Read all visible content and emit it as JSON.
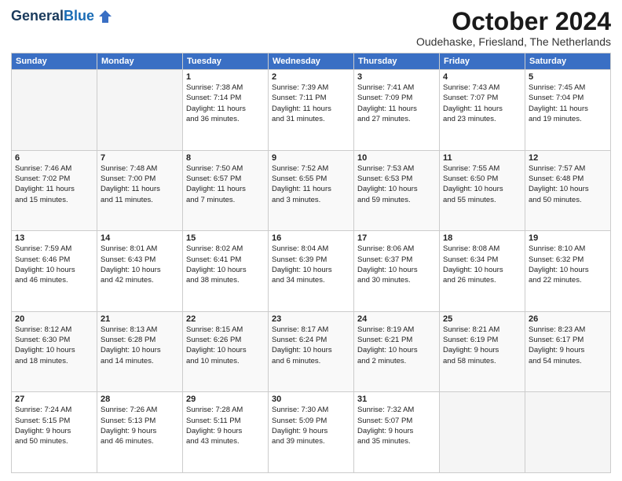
{
  "header": {
    "logo_general": "General",
    "logo_blue": "Blue",
    "month_title": "October 2024",
    "location": "Oudehaske, Friesland, The Netherlands"
  },
  "weekdays": [
    "Sunday",
    "Monday",
    "Tuesday",
    "Wednesday",
    "Thursday",
    "Friday",
    "Saturday"
  ],
  "weeks": [
    [
      {
        "day": "",
        "info": ""
      },
      {
        "day": "",
        "info": ""
      },
      {
        "day": "1",
        "info": "Sunrise: 7:38 AM\nSunset: 7:14 PM\nDaylight: 11 hours\nand 36 minutes."
      },
      {
        "day": "2",
        "info": "Sunrise: 7:39 AM\nSunset: 7:11 PM\nDaylight: 11 hours\nand 31 minutes."
      },
      {
        "day": "3",
        "info": "Sunrise: 7:41 AM\nSunset: 7:09 PM\nDaylight: 11 hours\nand 27 minutes."
      },
      {
        "day": "4",
        "info": "Sunrise: 7:43 AM\nSunset: 7:07 PM\nDaylight: 11 hours\nand 23 minutes."
      },
      {
        "day": "5",
        "info": "Sunrise: 7:45 AM\nSunset: 7:04 PM\nDaylight: 11 hours\nand 19 minutes."
      }
    ],
    [
      {
        "day": "6",
        "info": "Sunrise: 7:46 AM\nSunset: 7:02 PM\nDaylight: 11 hours\nand 15 minutes."
      },
      {
        "day": "7",
        "info": "Sunrise: 7:48 AM\nSunset: 7:00 PM\nDaylight: 11 hours\nand 11 minutes."
      },
      {
        "day": "8",
        "info": "Sunrise: 7:50 AM\nSunset: 6:57 PM\nDaylight: 11 hours\nand 7 minutes."
      },
      {
        "day": "9",
        "info": "Sunrise: 7:52 AM\nSunset: 6:55 PM\nDaylight: 11 hours\nand 3 minutes."
      },
      {
        "day": "10",
        "info": "Sunrise: 7:53 AM\nSunset: 6:53 PM\nDaylight: 10 hours\nand 59 minutes."
      },
      {
        "day": "11",
        "info": "Sunrise: 7:55 AM\nSunset: 6:50 PM\nDaylight: 10 hours\nand 55 minutes."
      },
      {
        "day": "12",
        "info": "Sunrise: 7:57 AM\nSunset: 6:48 PM\nDaylight: 10 hours\nand 50 minutes."
      }
    ],
    [
      {
        "day": "13",
        "info": "Sunrise: 7:59 AM\nSunset: 6:46 PM\nDaylight: 10 hours\nand 46 minutes."
      },
      {
        "day": "14",
        "info": "Sunrise: 8:01 AM\nSunset: 6:43 PM\nDaylight: 10 hours\nand 42 minutes."
      },
      {
        "day": "15",
        "info": "Sunrise: 8:02 AM\nSunset: 6:41 PM\nDaylight: 10 hours\nand 38 minutes."
      },
      {
        "day": "16",
        "info": "Sunrise: 8:04 AM\nSunset: 6:39 PM\nDaylight: 10 hours\nand 34 minutes."
      },
      {
        "day": "17",
        "info": "Sunrise: 8:06 AM\nSunset: 6:37 PM\nDaylight: 10 hours\nand 30 minutes."
      },
      {
        "day": "18",
        "info": "Sunrise: 8:08 AM\nSunset: 6:34 PM\nDaylight: 10 hours\nand 26 minutes."
      },
      {
        "day": "19",
        "info": "Sunrise: 8:10 AM\nSunset: 6:32 PM\nDaylight: 10 hours\nand 22 minutes."
      }
    ],
    [
      {
        "day": "20",
        "info": "Sunrise: 8:12 AM\nSunset: 6:30 PM\nDaylight: 10 hours\nand 18 minutes."
      },
      {
        "day": "21",
        "info": "Sunrise: 8:13 AM\nSunset: 6:28 PM\nDaylight: 10 hours\nand 14 minutes."
      },
      {
        "day": "22",
        "info": "Sunrise: 8:15 AM\nSunset: 6:26 PM\nDaylight: 10 hours\nand 10 minutes."
      },
      {
        "day": "23",
        "info": "Sunrise: 8:17 AM\nSunset: 6:24 PM\nDaylight: 10 hours\nand 6 minutes."
      },
      {
        "day": "24",
        "info": "Sunrise: 8:19 AM\nSunset: 6:21 PM\nDaylight: 10 hours\nand 2 minutes."
      },
      {
        "day": "25",
        "info": "Sunrise: 8:21 AM\nSunset: 6:19 PM\nDaylight: 9 hours\nand 58 minutes."
      },
      {
        "day": "26",
        "info": "Sunrise: 8:23 AM\nSunset: 6:17 PM\nDaylight: 9 hours\nand 54 minutes."
      }
    ],
    [
      {
        "day": "27",
        "info": "Sunrise: 7:24 AM\nSunset: 5:15 PM\nDaylight: 9 hours\nand 50 minutes."
      },
      {
        "day": "28",
        "info": "Sunrise: 7:26 AM\nSunset: 5:13 PM\nDaylight: 9 hours\nand 46 minutes."
      },
      {
        "day": "29",
        "info": "Sunrise: 7:28 AM\nSunset: 5:11 PM\nDaylight: 9 hours\nand 43 minutes."
      },
      {
        "day": "30",
        "info": "Sunrise: 7:30 AM\nSunset: 5:09 PM\nDaylight: 9 hours\nand 39 minutes."
      },
      {
        "day": "31",
        "info": "Sunrise: 7:32 AM\nSunset: 5:07 PM\nDaylight: 9 hours\nand 35 minutes."
      },
      {
        "day": "",
        "info": ""
      },
      {
        "day": "",
        "info": ""
      }
    ]
  ]
}
